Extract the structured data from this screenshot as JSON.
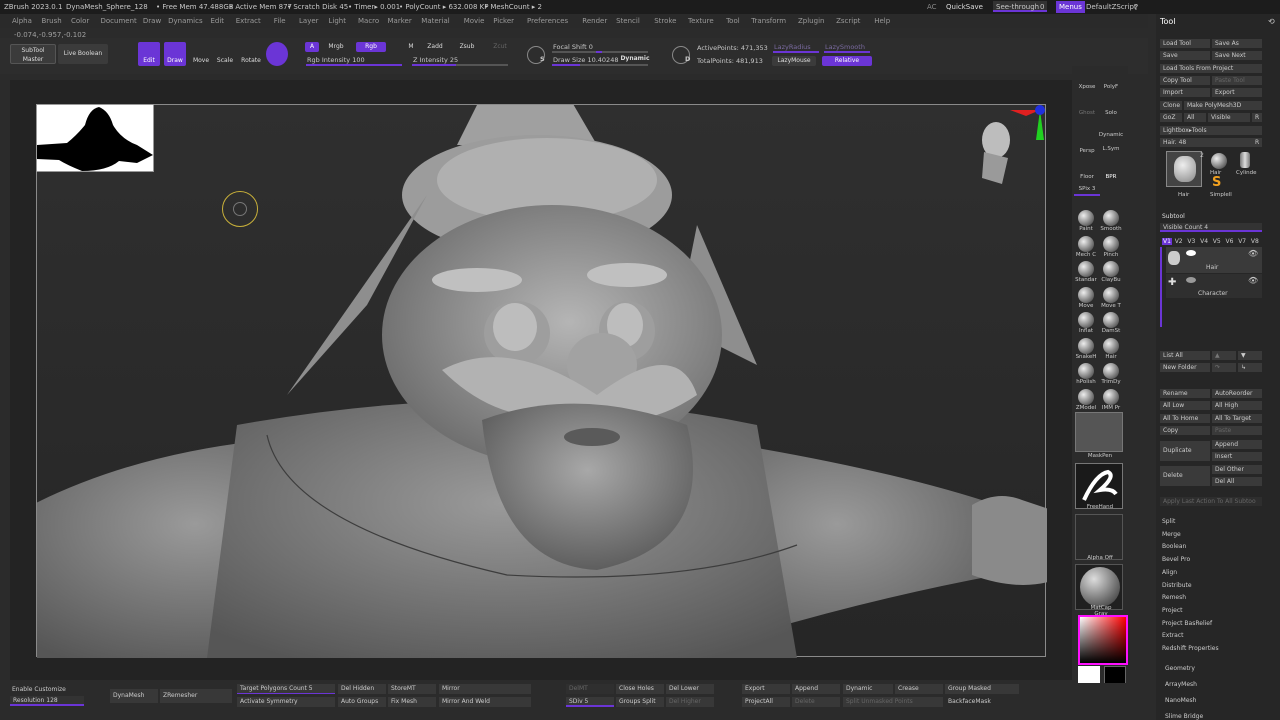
{
  "titlebar": {
    "app": "ZBrush 2023.0.1",
    "doc": "DynaMesh_Sphere_128",
    "free_mem": "• Free Mem 47.488GB",
    "active_mem": "• Active Mem 877",
    "scratch": "• Scratch Disk 45",
    "timer": "• Timer▸ 0.001",
    "polycount": "• PolyCount ▸ 632.008 KP",
    "meshcount": "• MeshCount ▸ 2",
    "ac": "AC",
    "quicksave": "QuickSave",
    "seethrough": "See-through",
    "seethrough_val": "0",
    "menus": "Menus",
    "zscript": "DefaultZScript"
  },
  "menubar": [
    "Alpha",
    "Brush",
    "Color",
    "Document",
    "Draw",
    "Dynamics",
    "Edit",
    "Extract",
    "File",
    "Layer",
    "Light",
    "Macro",
    "Marker",
    "Material",
    "Movie",
    "Picker",
    "Preferences",
    "Render",
    "Stencil",
    "Stroke",
    "Texture",
    "Tool",
    "Transform",
    "Zplugin",
    "Zscript",
    "Help"
  ],
  "coords": "-0.074,-0.957,-0.102",
  "toptools": {
    "subtool_master": "SubTool Master",
    "live_boolean": "Live Boolean",
    "edit": "Edit",
    "draw": "Draw",
    "move": "Move",
    "scale": "Scale",
    "rotate": "Rotate",
    "a": "A",
    "mrgb": "Mrgb",
    "rgb": "Rgb",
    "m": "M",
    "zadd": "Zadd",
    "zsub": "Zsub",
    "zcut": "Zcut",
    "rgb_intensity": "Rgb Intensity 100",
    "z_intensity": "Z Intensity 25",
    "focal_shift": "Focal Shift 0",
    "draw_size": "Draw Size 10.40248",
    "dynamic": "Dynamic",
    "active_points": "ActivePoints: 471,353",
    "total_points": "TotalPoints: 481,913",
    "lazy_radius": "LazyRadius",
    "lazy_smooth": "LazySmooth",
    "lazy_mouse": "LazyMouse",
    "relative": "Relative",
    "s": "S",
    "d": "D"
  },
  "righttools": {
    "xpose": "Xpose",
    "polyf": "PolyF",
    "ghost": "Ghost",
    "solo": "Solo",
    "persp": "Persp",
    "dynamic": "Dynamic",
    "lsym": "L.Sym",
    "floor": "Floor",
    "bpr": "BPR",
    "spix": "SPix 3",
    "brushes": [
      [
        "Paint",
        "Smooth"
      ],
      [
        "Mech C",
        "Pinch"
      ],
      [
        "Standar",
        "ClayBu"
      ],
      [
        "Move",
        "Move T"
      ],
      [
        "Inflat",
        "DamSt"
      ],
      [
        "SnakeH",
        "Hair"
      ],
      [
        "hPolish",
        "TrimDy"
      ],
      [
        "ZModel",
        "IMM Pr"
      ]
    ],
    "maskpen": "MaskPen",
    "freehand": "FreeHand",
    "alpha_off": "Alpha Off",
    "matcap": "MatCap Gray"
  },
  "tray": {
    "title": "Tool",
    "load_tool": "Load Tool",
    "save_as": "Save As",
    "save": "Save",
    "save_next": "Save Next",
    "load_from_project": "Load Tools From Project",
    "copy_tool": "Copy Tool",
    "paste_tool": "Paste Tool",
    "import": "Import",
    "export": "Export",
    "clone": "Clone",
    "make_polymesh": "Make PolyMesh3D",
    "goz": "GoZ",
    "all": "All",
    "visible": "Visible",
    "r": "R",
    "lightbox_tools": "Lightbox▸Tools",
    "hair_slider": "Hair. 48",
    "thumb_labels": [
      "Hair",
      "Hair",
      "Cylinde",
      "Simplell"
    ],
    "thumb_count": "2",
    "subtool": "Subtool",
    "visible_count": "Visible Count 4",
    "versions": [
      "V1",
      "V2",
      "V3",
      "V4",
      "V5",
      "V6",
      "V7",
      "V8"
    ],
    "subtools": [
      "Hair",
      "Character"
    ],
    "list_all": "List All",
    "new_folder": "New Folder",
    "rename": "Rename",
    "autoreorder": "AutoReorder",
    "all_low": "All Low",
    "all_high": "All High",
    "all_to_home": "All To Home",
    "all_to_target": "All To Target",
    "copy": "Copy",
    "paste": "Paste",
    "duplicate": "Duplicate",
    "append": "Append",
    "insert": "Insert",
    "delete": "Delete",
    "del_other": "Del Other",
    "del_all": "Del All",
    "apply_last": "Apply Last Action To All Subtoo",
    "sections": [
      "Split",
      "Merge",
      "Boolean",
      "Bevel Pro",
      "Align",
      "Distribute",
      "Remesh",
      "Project",
      "Project BasRelief",
      "Extract",
      "Redshift Properties"
    ],
    "bottom_sections": [
      "Geometry",
      "ArrayMesh",
      "NanoMesh",
      "Slime Bridge"
    ]
  },
  "bottom": {
    "enable_customize": "Enable Customize",
    "resolution": "Resolution 128",
    "dynamesh": "DynaMesh",
    "zremesher": "ZRemesher",
    "target_polygons": "Target Polygons Count 5",
    "activate_symmetry": "Activate Symmetry",
    "del_hidden": "Del Hidden",
    "auto_groups": "Auto Groups",
    "storemt": "StoreMT",
    "fix_mesh": "Fix Mesh",
    "mirror": "Mirror",
    "mirror_weld": "Mirror And Weld",
    "delmt": "DelMT",
    "sdiv": "SDiv 5",
    "close_holes": "Close Holes",
    "groups_split": "Groups Split",
    "del_lower": "Del Lower",
    "del_higher": "Del Higher",
    "export": "Export",
    "projectall": "ProjectAll",
    "append": "Append",
    "delete": "Delete",
    "dynamic": "Dynamic",
    "split_unmasked": "Split Unmasked Points",
    "crease": "Crease",
    "group_masked": "Group Masked",
    "backfacemask": "BackfaceMask"
  },
  "colors": {
    "accent": "#6b35d6",
    "background": "#2b2b2b",
    "canvas": "#2a2a2a"
  }
}
